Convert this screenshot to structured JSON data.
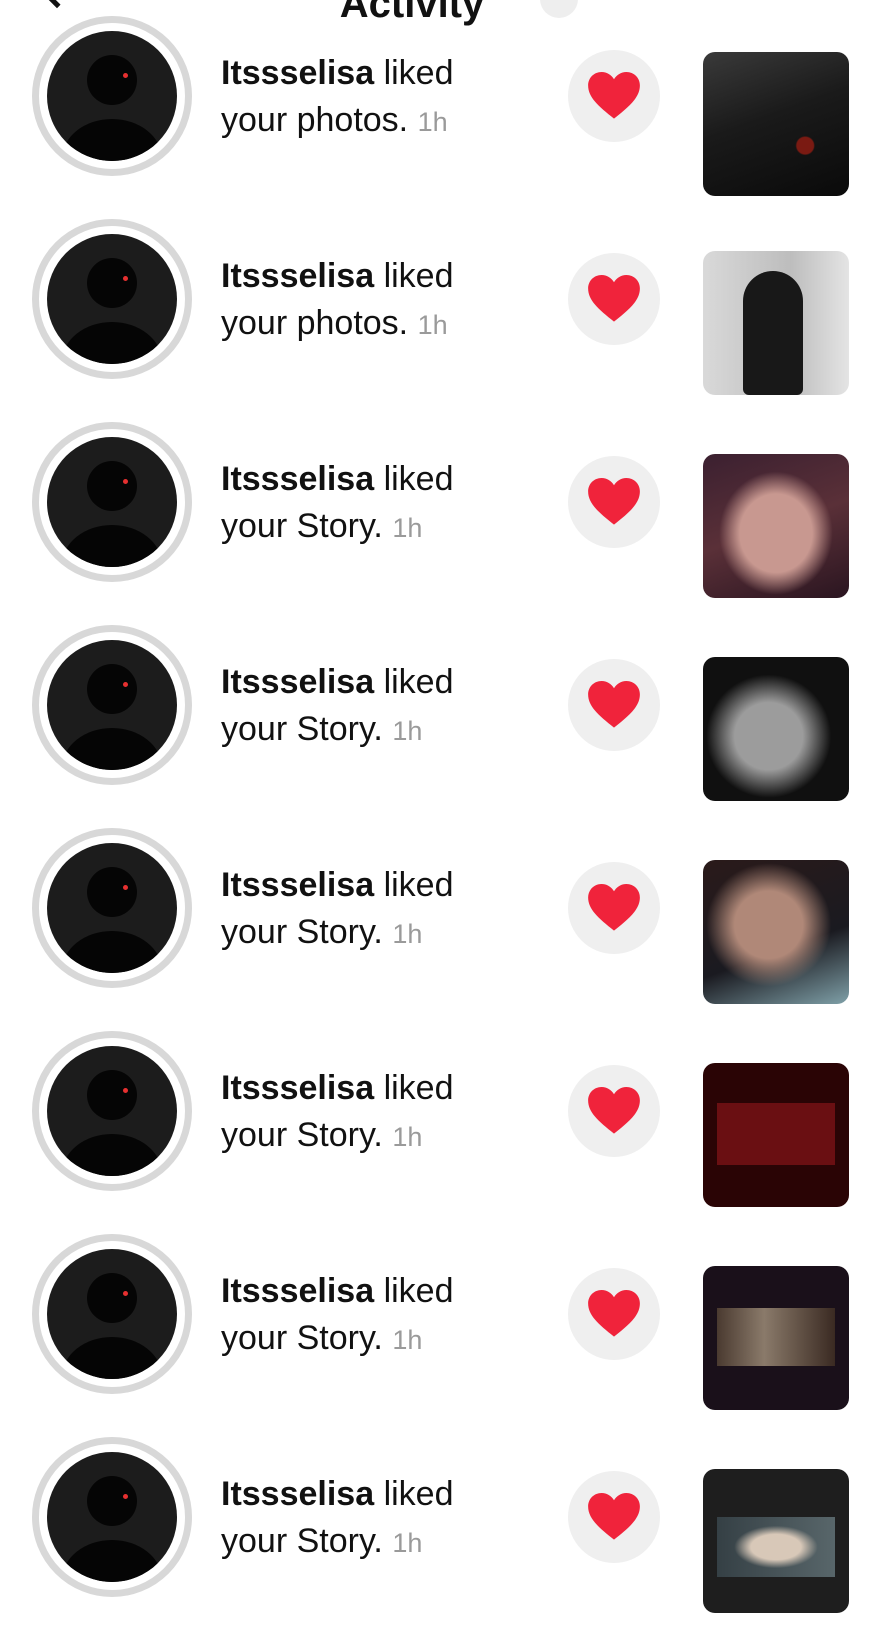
{
  "header": {
    "title": "Activity"
  },
  "notifications": [
    {
      "username": "Itssselisa",
      "action": "liked",
      "object": "your photos.",
      "time": "1h"
    },
    {
      "username": "Itssselisa",
      "action": "liked",
      "object": "your photos.",
      "time": "1h"
    },
    {
      "username": "Itssselisa",
      "action": "liked",
      "object": "your Story.",
      "time": "1h"
    },
    {
      "username": "Itssselisa",
      "action": "liked",
      "object": "your Story.",
      "time": "1h"
    },
    {
      "username": "Itssselisa",
      "action": "liked",
      "object": "your Story.",
      "time": "1h"
    },
    {
      "username": "Itssselisa",
      "action": "liked",
      "object": "your Story.",
      "time": "1h"
    },
    {
      "username": "Itssselisa",
      "action": "liked",
      "object": "your Story.",
      "time": "1h"
    },
    {
      "username": "Itssselisa",
      "action": "liked",
      "object": "your Story.",
      "time": "1h"
    }
  ],
  "icons": {
    "back": "chevron-left-icon",
    "dropdown": "chevron-down-icon",
    "like": "heart-icon"
  },
  "colors": {
    "heart": "#f0233b",
    "heart_bg": "#efefef",
    "avatar_ring": "#d8d8d8",
    "time_text": "#9a9a9a"
  }
}
